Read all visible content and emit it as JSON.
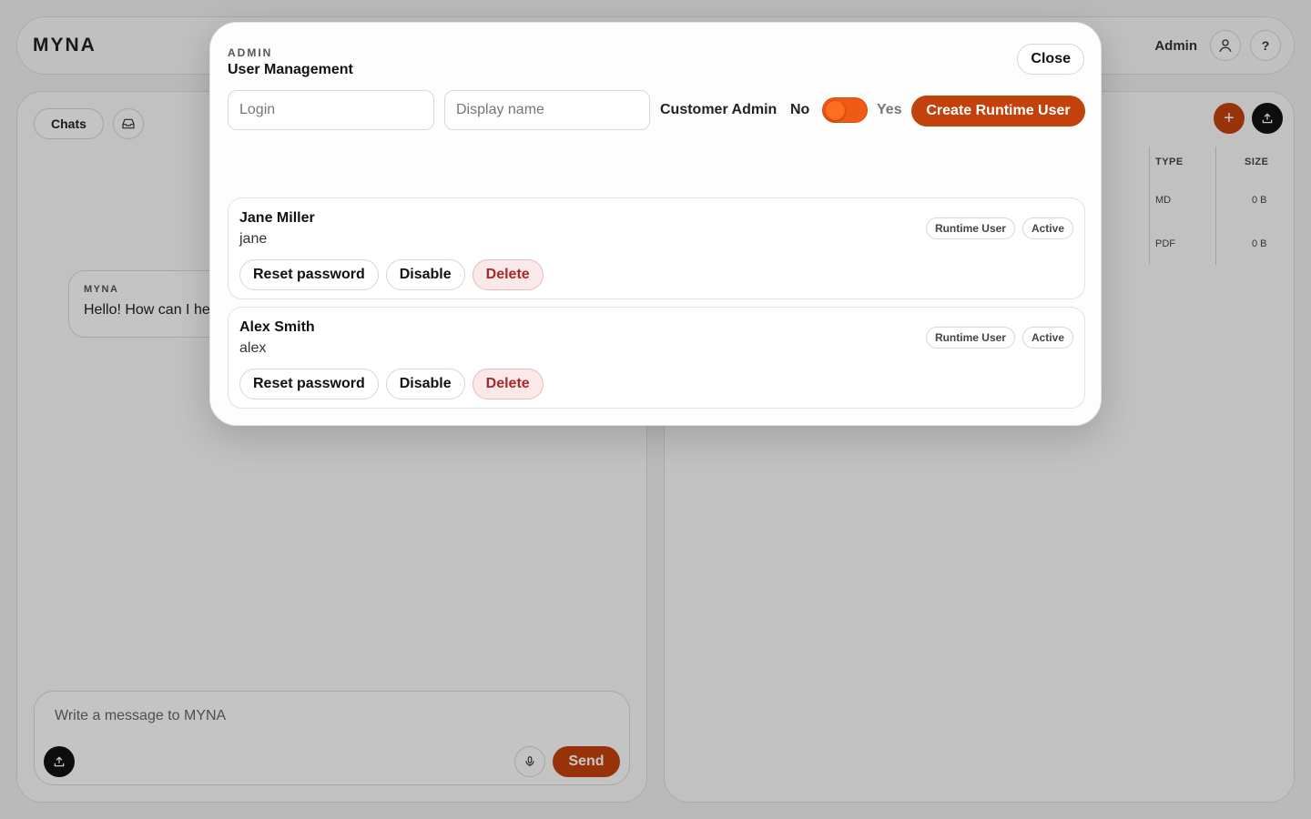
{
  "app": {
    "brand": "MYNA",
    "user_label": "Admin",
    "help_label": "?"
  },
  "chat": {
    "tab_label": "Chats",
    "message": {
      "sender": "MYNA",
      "text": "Hello! How can I he"
    },
    "composer_placeholder": "Write a message to MYNA",
    "send_label": "Send"
  },
  "files": {
    "add_label": "+",
    "columns": [
      "TYPE",
      "SIZE"
    ],
    "rows": [
      {
        "type": "MD",
        "size": "0 B"
      },
      {
        "type": "PDF",
        "size": "0 B"
      }
    ]
  },
  "modal": {
    "kicker": "ADMIN",
    "title": "User Management",
    "close_label": "Close",
    "form": {
      "login_placeholder": "Login",
      "display_placeholder": "Display name",
      "customer_admin_label": "Customer Admin",
      "no_label": "No",
      "yes_label": "Yes",
      "customer_admin_value": false,
      "create_label": "Create Runtime User"
    },
    "users": [
      {
        "name": "Jane Miller",
        "login": "jane",
        "role": "Runtime User",
        "status": "Active",
        "reset_label": "Reset password",
        "disable_label": "Disable",
        "delete_label": "Delete"
      },
      {
        "name": "Alex Smith",
        "login": "alex",
        "role": "Runtime User",
        "status": "Active",
        "reset_label": "Reset password",
        "disable_label": "Disable",
        "delete_label": "Delete"
      }
    ]
  },
  "colors": {
    "accent": "#c2410c",
    "toggle": "#f05a14",
    "danger_text": "#a62828",
    "danger_bg": "#fbe9e9"
  }
}
